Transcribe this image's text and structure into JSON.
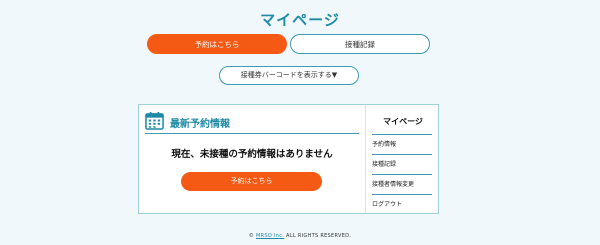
{
  "page": {
    "title": "マイページ"
  },
  "tabs": [
    {
      "label": "予約はこちら",
      "active": true
    },
    {
      "label": "接種記録",
      "active": false
    }
  ],
  "barcode_button": {
    "label": "接種券バーコードを表示する▼"
  },
  "latest": {
    "heading": "最新予約情報",
    "icon": "calendar-icon",
    "message": "現在、未接種の予約情報はありません",
    "reserve_label": "予約はこちら"
  },
  "sidebar": {
    "title": "マイページ",
    "items": [
      {
        "label": "予約情報"
      },
      {
        "label": "接種記録"
      },
      {
        "label": "接種者情報変更"
      },
      {
        "label": "ログアウト"
      }
    ]
  },
  "footer": {
    "prefix": "© ",
    "company": "MRSO Inc.",
    "suffix": " ALL RIGHTS RESERVED."
  },
  "colors": {
    "accent": "#1f8aa6",
    "primary_button": "#f45a14",
    "background": "#f0f8fb"
  }
}
